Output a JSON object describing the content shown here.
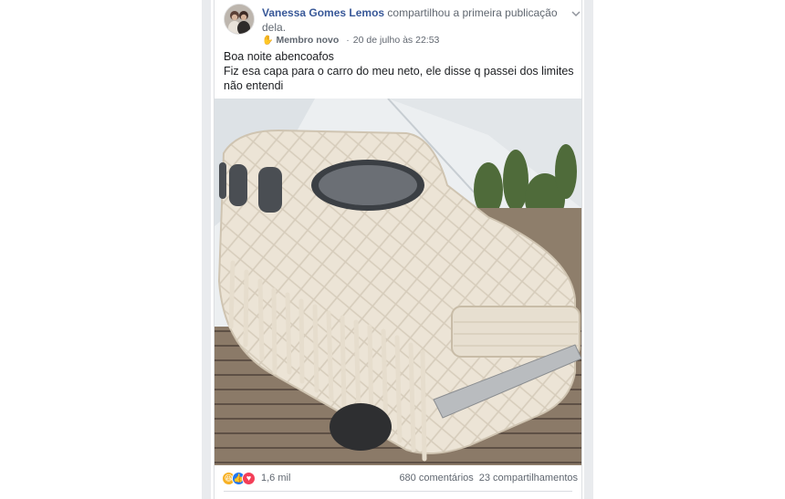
{
  "post": {
    "author": "Vanessa Gomes Lemos",
    "action": "compartilhou a primeira publicação dela.",
    "badge": "Membro novo",
    "separator": "·",
    "timestamp": "20 de julho às 22:53",
    "text_line1": "Boa noite abencoafos",
    "text_line2": "Fiz esa capa para o carro do meu neto, ele disse q passei dos limites não entendi"
  },
  "footer": {
    "reaction_icons": [
      "haha-icon",
      "like-icon",
      "love-icon"
    ],
    "reaction_count": "1,6 mil",
    "comments": "680 comentários",
    "shares": "23 compartilhamentos"
  },
  "colors": {
    "author_link": "#385898",
    "secondary_text": "#606770",
    "like": "#2078f4",
    "love": "#f33e58",
    "haha": "#f7b125"
  }
}
